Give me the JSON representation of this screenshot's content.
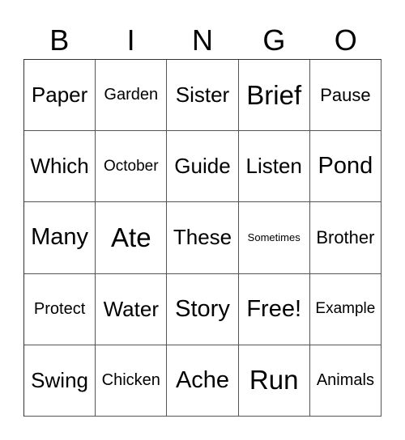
{
  "header": {
    "letters": [
      "B",
      "I",
      "N",
      "G",
      "O"
    ]
  },
  "card": {
    "rows": [
      [
        "Paper",
        "Garden",
        "Sister",
        "Brief",
        "Pause"
      ],
      [
        "Which",
        "October",
        "Guide",
        "Listen",
        "Pond"
      ],
      [
        "Many",
        "Ate",
        "These",
        "Sometimes",
        "Brother"
      ],
      [
        "Protect",
        "Water",
        "Story",
        "Free!",
        "Example"
      ],
      [
        "Swing",
        "Chicken",
        "Ache",
        "Run",
        "Animals"
      ]
    ]
  }
}
